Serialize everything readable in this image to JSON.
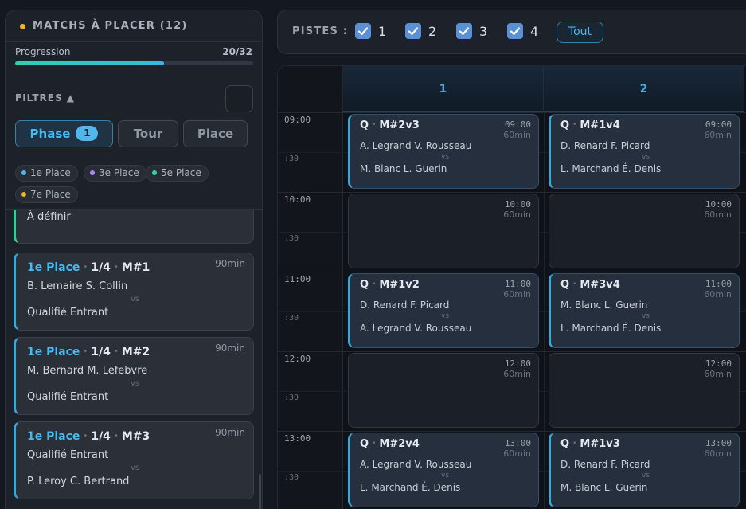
{
  "left_panel": {
    "title": "MATCHS À PLACER (12)",
    "accent_dot_color": "#f0b429",
    "progress": {
      "label": "Progression",
      "count": "20/32",
      "fraction": 0.625
    },
    "filters": {
      "label": "FILTRES ▲",
      "tabs": [
        {
          "label": "Phase",
          "badge": "1",
          "active": true
        },
        {
          "label": "Tour",
          "active": false
        },
        {
          "label": "Place",
          "active": false
        }
      ],
      "chips": [
        {
          "label": "1e Place",
          "color": "#4fb7ea"
        },
        {
          "label": "3e Place",
          "color": "#a78bfa"
        },
        {
          "label": "5e Place",
          "color": "#34d399"
        },
        {
          "label": "7e Place",
          "color": "#f0b429"
        }
      ]
    },
    "matches": [
      {
        "phase": "",
        "round": "",
        "id": "",
        "duration": "",
        "p1": "",
        "vs": "vs",
        "p2": "À définir",
        "color": "#2fcf8f"
      },
      {
        "phase": "1e Place",
        "round": "1/4",
        "id": "M#1",
        "duration": "90min",
        "p1": "B. Lemaire S. Collin",
        "vs": "vs",
        "p2": "Qualifié Entrant",
        "color": "#3aa6da"
      },
      {
        "phase": "1e Place",
        "round": "1/4",
        "id": "M#2",
        "duration": "90min",
        "p1": "M. Bernard M. Lefebvre",
        "vs": "vs",
        "p2": "Qualifié Entrant",
        "color": "#3aa6da"
      },
      {
        "phase": "1e Place",
        "round": "1/4",
        "id": "M#3",
        "duration": "90min",
        "p1": "Qualifié Entrant",
        "vs": "vs",
        "p2": "P. Leroy C. Bertrand",
        "color": "#3aa6da"
      }
    ]
  },
  "topbar": {
    "label": "PISTES :",
    "pistes": [
      {
        "label": "1",
        "checked": true
      },
      {
        "label": "2",
        "checked": true
      },
      {
        "label": "3",
        "checked": true
      },
      {
        "label": "4",
        "checked": true
      }
    ],
    "all_button": "Tout"
  },
  "grid": {
    "courts": [
      "1",
      "2"
    ],
    "times": [
      "09:00",
      ":30",
      "10:00",
      ":30",
      "11:00",
      ":30",
      "12:00",
      ":30",
      "13:00",
      ":30"
    ],
    "slots": [
      {
        "court": 0,
        "row": 0,
        "time": "09:00",
        "duration": "60min",
        "filled": true,
        "phase": "Q",
        "id": "M#2v3",
        "p1": "A. Legrand V. Rousseau",
        "vs": "vs",
        "p2": "M. Blanc L. Guerin"
      },
      {
        "court": 1,
        "row": 0,
        "time": "09:00",
        "duration": "60min",
        "filled": true,
        "phase": "Q",
        "id": "M#1v4",
        "p1": "D. Renard F. Picard",
        "vs": "vs",
        "p2": "L. Marchand É. Denis"
      },
      {
        "court": 0,
        "row": 1,
        "time": "10:00",
        "duration": "60min",
        "filled": false
      },
      {
        "court": 1,
        "row": 1,
        "time": "10:00",
        "duration": "60min",
        "filled": false
      },
      {
        "court": 0,
        "row": 2,
        "time": "11:00",
        "duration": "60min",
        "filled": true,
        "phase": "Q",
        "id": "M#1v2",
        "p1": "D. Renard F. Picard",
        "vs": "vs",
        "p2": "A. Legrand V. Rousseau"
      },
      {
        "court": 1,
        "row": 2,
        "time": "11:00",
        "duration": "60min",
        "filled": true,
        "phase": "Q",
        "id": "M#3v4",
        "p1": "M. Blanc L. Guerin",
        "vs": "vs",
        "p2": "L. Marchand É. Denis"
      },
      {
        "court": 0,
        "row": 3,
        "time": "12:00",
        "duration": "60min",
        "filled": false
      },
      {
        "court": 1,
        "row": 3,
        "time": "12:00",
        "duration": "60min",
        "filled": false
      },
      {
        "court": 0,
        "row": 4,
        "time": "13:00",
        "duration": "60min",
        "filled": true,
        "phase": "Q",
        "id": "M#2v4",
        "p1": "A. Legrand V. Rousseau",
        "vs": "vs",
        "p2": "L. Marchand É. Denis"
      },
      {
        "court": 1,
        "row": 4,
        "time": "13:00",
        "duration": "60min",
        "filled": true,
        "phase": "Q",
        "id": "M#1v3",
        "p1": "D. Renard F. Picard",
        "vs": "vs",
        "p2": "M. Blanc L. Guerin"
      }
    ]
  }
}
